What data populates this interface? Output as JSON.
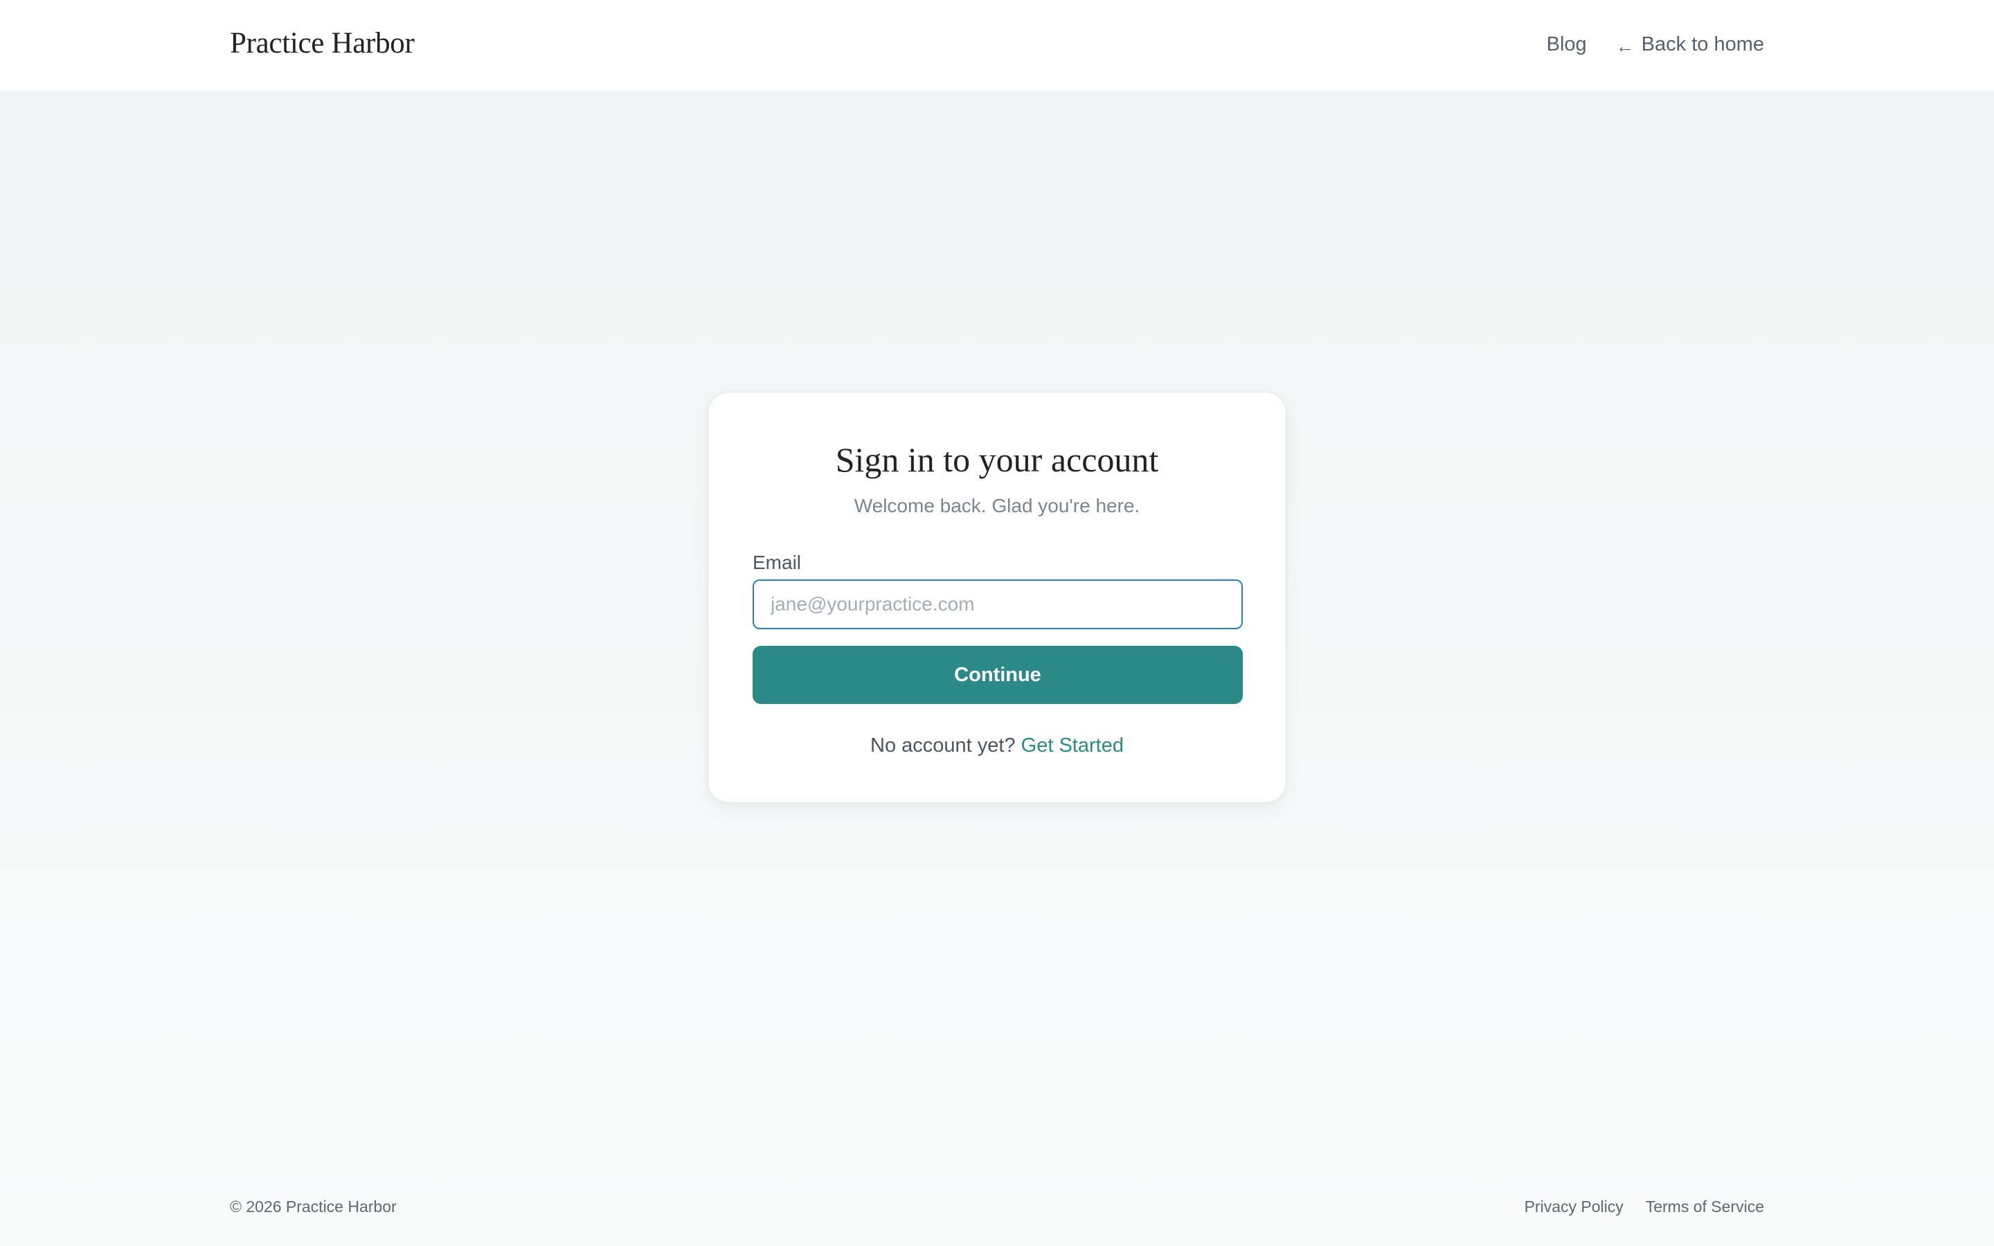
{
  "header": {
    "brand": "Practice Harbor",
    "nav": {
      "blog": "Blog",
      "back_arrow": "←",
      "back_label": "Back to home"
    }
  },
  "signin": {
    "title": "Sign in to your account",
    "subtitle": "Welcome back. Glad you're here.",
    "email_label": "Email",
    "email_value": "",
    "email_placeholder": "jane@yourpractice.com",
    "continue_label": "Continue",
    "no_account_text": "No account yet?",
    "get_started_link": "Get Started"
  },
  "footer": {
    "copyright": "© 2026 Practice Harbor",
    "links": [
      "Privacy Policy",
      "Terms of Service"
    ]
  },
  "colors": {
    "accent": "#2b8a87",
    "input_focus_border": "#2d7fc4",
    "background": "#eff6f5"
  },
  "icons": {
    "back": "arrow-left-icon"
  }
}
